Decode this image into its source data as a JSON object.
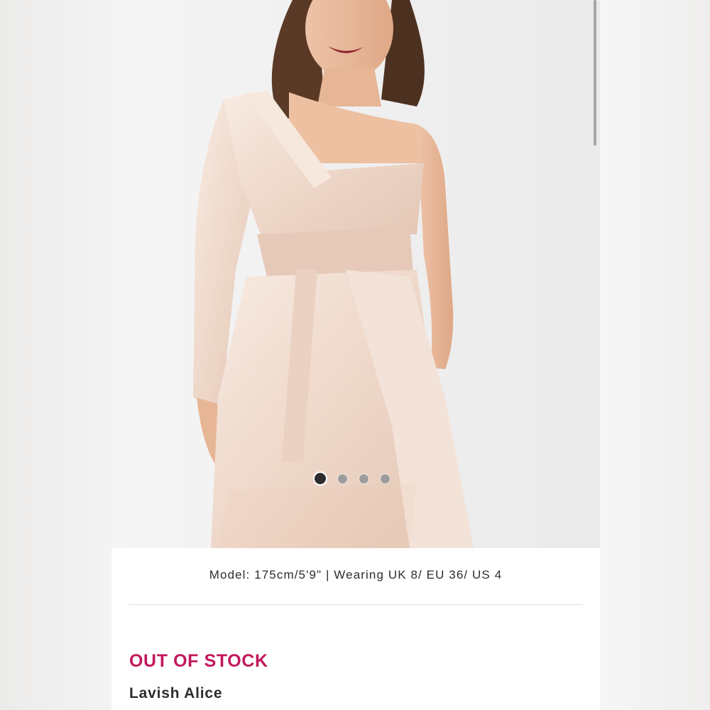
{
  "product": {
    "model_info": "Model: 175cm/5'9\" | Wearing UK 8/ EU 36/ US 4",
    "stock_status": "OUT OF STOCK",
    "brand": "Lavish Alice"
  },
  "gallery": {
    "image_count": 4,
    "active_index": 0
  },
  "colors": {
    "stock_status": "#c2185b",
    "dress": "#f1ddd0",
    "text": "#2d2d2d",
    "active_dot": "#2d2d2d",
    "inactive_dot": "#9c9c9c"
  }
}
